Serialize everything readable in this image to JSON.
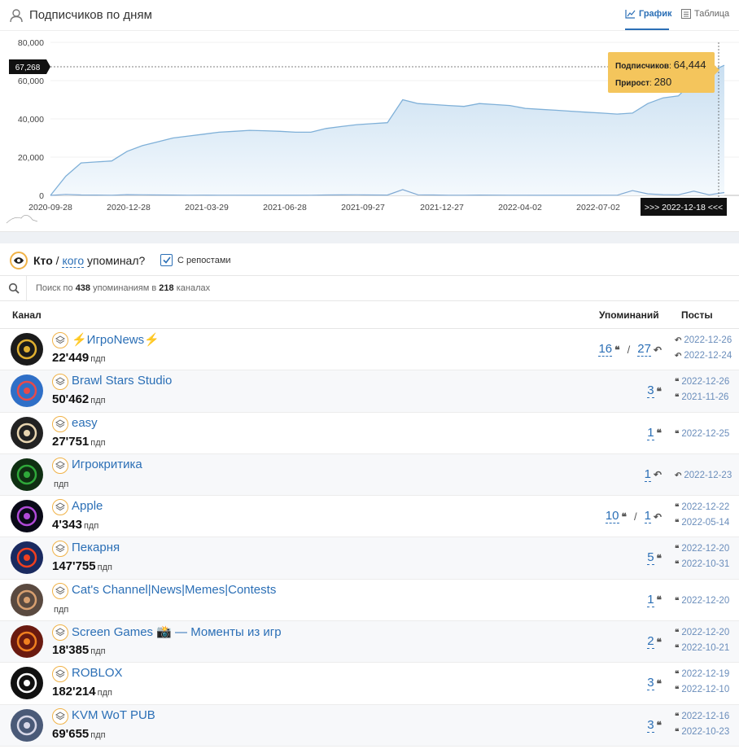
{
  "chart_panel": {
    "title": "Подписчиков по дням",
    "tabs": [
      {
        "label": "График",
        "active": true
      },
      {
        "label": "Таблица",
        "active": false
      }
    ]
  },
  "chart_data": {
    "type": "area",
    "y_ticks": [
      "80,000",
      "60,000",
      "40,000",
      "20,000",
      "0"
    ],
    "ylim": [
      0,
      80000
    ],
    "x_ticks": [
      "2020-09-28",
      "2020-12-28",
      "2021-03-29",
      "2021-06-28",
      "2021-09-27",
      "2021-12-27",
      "2022-04-02",
      "2022-07-02"
    ],
    "highlight_x_label": ">>> 2022-12-18 <<<",
    "crosshair_y_label": "67,268",
    "series": [
      {
        "values": [
          0,
          10000,
          17000,
          17500,
          18000,
          23000,
          26000,
          28000,
          30000,
          31000,
          32000,
          33000,
          33500,
          34000,
          33800,
          33500,
          33000,
          33000,
          35000,
          36000,
          37000,
          37500,
          38000,
          50000,
          48000,
          47500,
          47000,
          46500,
          48000,
          47500,
          47000,
          45500,
          45000,
          44500,
          44000,
          43500,
          43000,
          42500,
          43000,
          48000,
          51000,
          52000,
          60000,
          64444,
          68000
        ]
      },
      {
        "values": [
          0,
          500,
          200,
          150,
          100,
          400,
          300,
          200,
          150,
          100,
          120,
          100,
          80,
          60,
          50,
          40,
          60,
          80,
          200,
          250,
          300,
          200,
          150,
          3000,
          300,
          200,
          100,
          80,
          150,
          120,
          100,
          80,
          60,
          50,
          40,
          60,
          80,
          100,
          2500,
          800,
          400,
          300,
          2200,
          280,
          1500
        ]
      }
    ],
    "tooltip": {
      "subs_label": "Подписчиков",
      "subs_value": "64,444",
      "gain_label": "Прирост",
      "gain_value": "280"
    }
  },
  "mentions": {
    "who_prefix": "Кто",
    "who_link": "кого",
    "who_suffix": "упоминал?",
    "reposts_label": "С репостами",
    "reposts_checked": true,
    "search": {
      "prefix": "Поиск по",
      "count": "438",
      "middle": "упоминаниям в",
      "channels": "218",
      "suffix": "каналах"
    },
    "columns": {
      "channel": "Канал",
      "mentions": "Упоминаний",
      "posts": "Посты"
    },
    "rows": [
      {
        "name": "⚡ИгроNews⚡",
        "subs": "22'449",
        "unit": "пдп",
        "m1": "16",
        "m1_icon": "quote-icon",
        "m2": "27",
        "m2_icon": "repost-icon",
        "posts": [
          {
            "icon": "repost-icon",
            "date": "2022-12-26"
          },
          {
            "icon": "repost-icon",
            "date": "2022-12-24"
          }
        ],
        "avatar": "#1b1b1b",
        "accent": "#e0b030"
      },
      {
        "name": "Brawl Stars Studio",
        "subs": "50'462",
        "unit": "пдп",
        "m1": "3",
        "m1_icon": "quote-icon",
        "m2": "",
        "m2_icon": "",
        "posts": [
          {
            "icon": "quote-icon",
            "date": "2022-12-26"
          },
          {
            "icon": "quote-icon",
            "date": "2021-11-26"
          }
        ],
        "avatar": "#2f6fc7",
        "accent": "#e84a4a"
      },
      {
        "name": "easy",
        "subs": "27'751",
        "unit": "пдп",
        "m1": "1",
        "m1_icon": "quote-icon",
        "m2": "",
        "m2_icon": "",
        "posts": [
          {
            "icon": "quote-icon",
            "date": "2022-12-25"
          }
        ],
        "avatar": "#222",
        "accent": "#e8d5b0"
      },
      {
        "name": "Игрокритика",
        "subs": "",
        "unit": "пдп",
        "m1": "1",
        "m1_icon": "repost-icon",
        "m2": "",
        "m2_icon": "",
        "posts": [
          {
            "icon": "repost-icon",
            "date": "2022-12-23"
          }
        ],
        "avatar": "#0f2f12",
        "accent": "#2fa83a"
      },
      {
        "name": "Apple",
        "subs": "4'343",
        "unit": "пдп",
        "m1": "10",
        "m1_icon": "quote-icon",
        "m2": "1",
        "m2_icon": "repost-icon",
        "posts": [
          {
            "icon": "quote-icon",
            "date": "2022-12-22"
          },
          {
            "icon": "quote-icon",
            "date": "2022-05-14"
          }
        ],
        "avatar": "#0a0a18",
        "accent": "#b04ad8"
      },
      {
        "name": "Пекарня",
        "subs": "147'755",
        "unit": "пдп",
        "m1": "5",
        "m1_icon": "quote-icon",
        "m2": "",
        "m2_icon": "",
        "posts": [
          {
            "icon": "quote-icon",
            "date": "2022-12-20"
          },
          {
            "icon": "quote-icon",
            "date": "2022-10-31"
          }
        ],
        "avatar": "#1a2a60",
        "accent": "#f04020"
      },
      {
        "name": "Cat's Channel|News|Memes|Contests",
        "subs": "",
        "unit": "пдп",
        "m1": "1",
        "m1_icon": "quote-icon",
        "m2": "",
        "m2_icon": "",
        "posts": [
          {
            "icon": "quote-icon",
            "date": "2022-12-20"
          }
        ],
        "avatar": "#5a4a40",
        "accent": "#d8a070"
      },
      {
        "name": "Screen Games 📸 — Моменты из игр",
        "subs": "18'385",
        "unit": "пдп",
        "m1": "2",
        "m1_icon": "quote-icon",
        "m2": "",
        "m2_icon": "",
        "posts": [
          {
            "icon": "quote-icon",
            "date": "2022-12-20"
          },
          {
            "icon": "quote-icon",
            "date": "2022-10-21"
          }
        ],
        "avatar": "#6a1a10",
        "accent": "#f08020"
      },
      {
        "name": "ROBLOX",
        "subs": "182'214",
        "unit": "пдп",
        "m1": "3",
        "m1_icon": "quote-icon",
        "m2": "",
        "m2_icon": "",
        "posts": [
          {
            "icon": "quote-icon",
            "date": "2022-12-19"
          },
          {
            "icon": "quote-icon",
            "date": "2022-12-10"
          }
        ],
        "avatar": "#111",
        "accent": "#ffffff"
      },
      {
        "name": "KVM WoT PUB",
        "subs": "69'655",
        "unit": "пдп",
        "m1": "3",
        "m1_icon": "quote-icon",
        "m2": "",
        "m2_icon": "",
        "posts": [
          {
            "icon": "quote-icon",
            "date": "2022-12-16"
          },
          {
            "icon": "quote-icon",
            "date": "2022-10-23"
          }
        ],
        "avatar": "#4a5a78",
        "accent": "#d8d8e8"
      }
    ]
  },
  "colors": {
    "accent": "#2b6fb6",
    "badge": "#f0b247",
    "area_fill": "#d6e8f5",
    "line": "#6fa8d6"
  }
}
